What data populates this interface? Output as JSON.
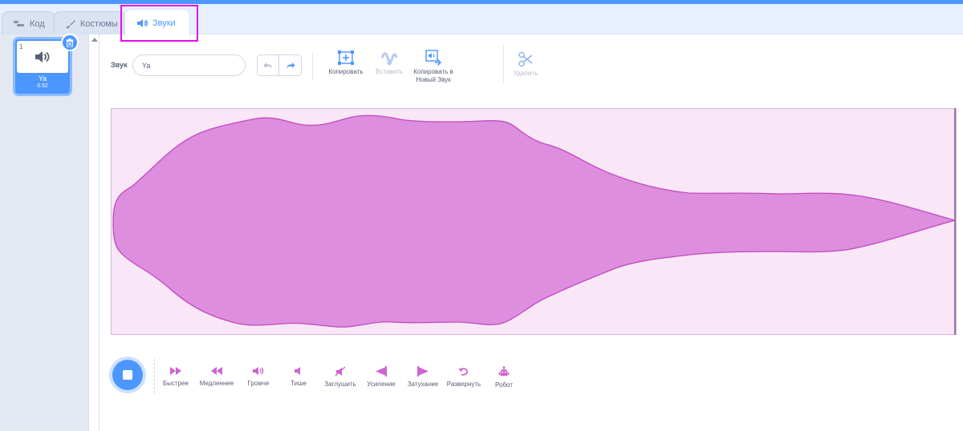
{
  "tabs": [
    {
      "label": "Код",
      "icon": "code-icon"
    },
    {
      "label": "Костюмы",
      "icon": "brush-icon"
    },
    {
      "label": "Звуки",
      "icon": "speaker-icon",
      "active": true
    }
  ],
  "sound_list": {
    "items": [
      {
        "index": "1",
        "name": "Ya",
        "duration": "0.52",
        "selected": true
      }
    ]
  },
  "editor": {
    "name_label": "Звук",
    "name_value": "Ya",
    "tools": {
      "copy": "Копировать",
      "paste": "Вставить",
      "copy_to_new_line1": "Копировать в",
      "copy_to_new_line2": "Новый Звук",
      "delete": "Удалить"
    }
  },
  "effects": [
    {
      "label": "Быстрее",
      "icon": "fast-forward-icon"
    },
    {
      "label": "Медленнее",
      "icon": "rewind-icon"
    },
    {
      "label": "Громче",
      "icon": "louder-icon"
    },
    {
      "label": "Тише",
      "icon": "softer-icon"
    },
    {
      "label": "Заглушить",
      "icon": "mute-icon"
    },
    {
      "label": "Усиление",
      "icon": "fade-in-icon"
    },
    {
      "label": "Затухание",
      "icon": "fade-out-icon"
    },
    {
      "label": "Развернуть",
      "icon": "reverse-icon"
    },
    {
      "label": "Робот",
      "icon": "robot-icon"
    }
  ],
  "colors": {
    "accent": "#4c97ff",
    "wave_fill": "#dd8ede",
    "wave_stroke": "#c14ac0",
    "wave_bg": "#f9e7f7",
    "highlight": "#e80ae8"
  }
}
